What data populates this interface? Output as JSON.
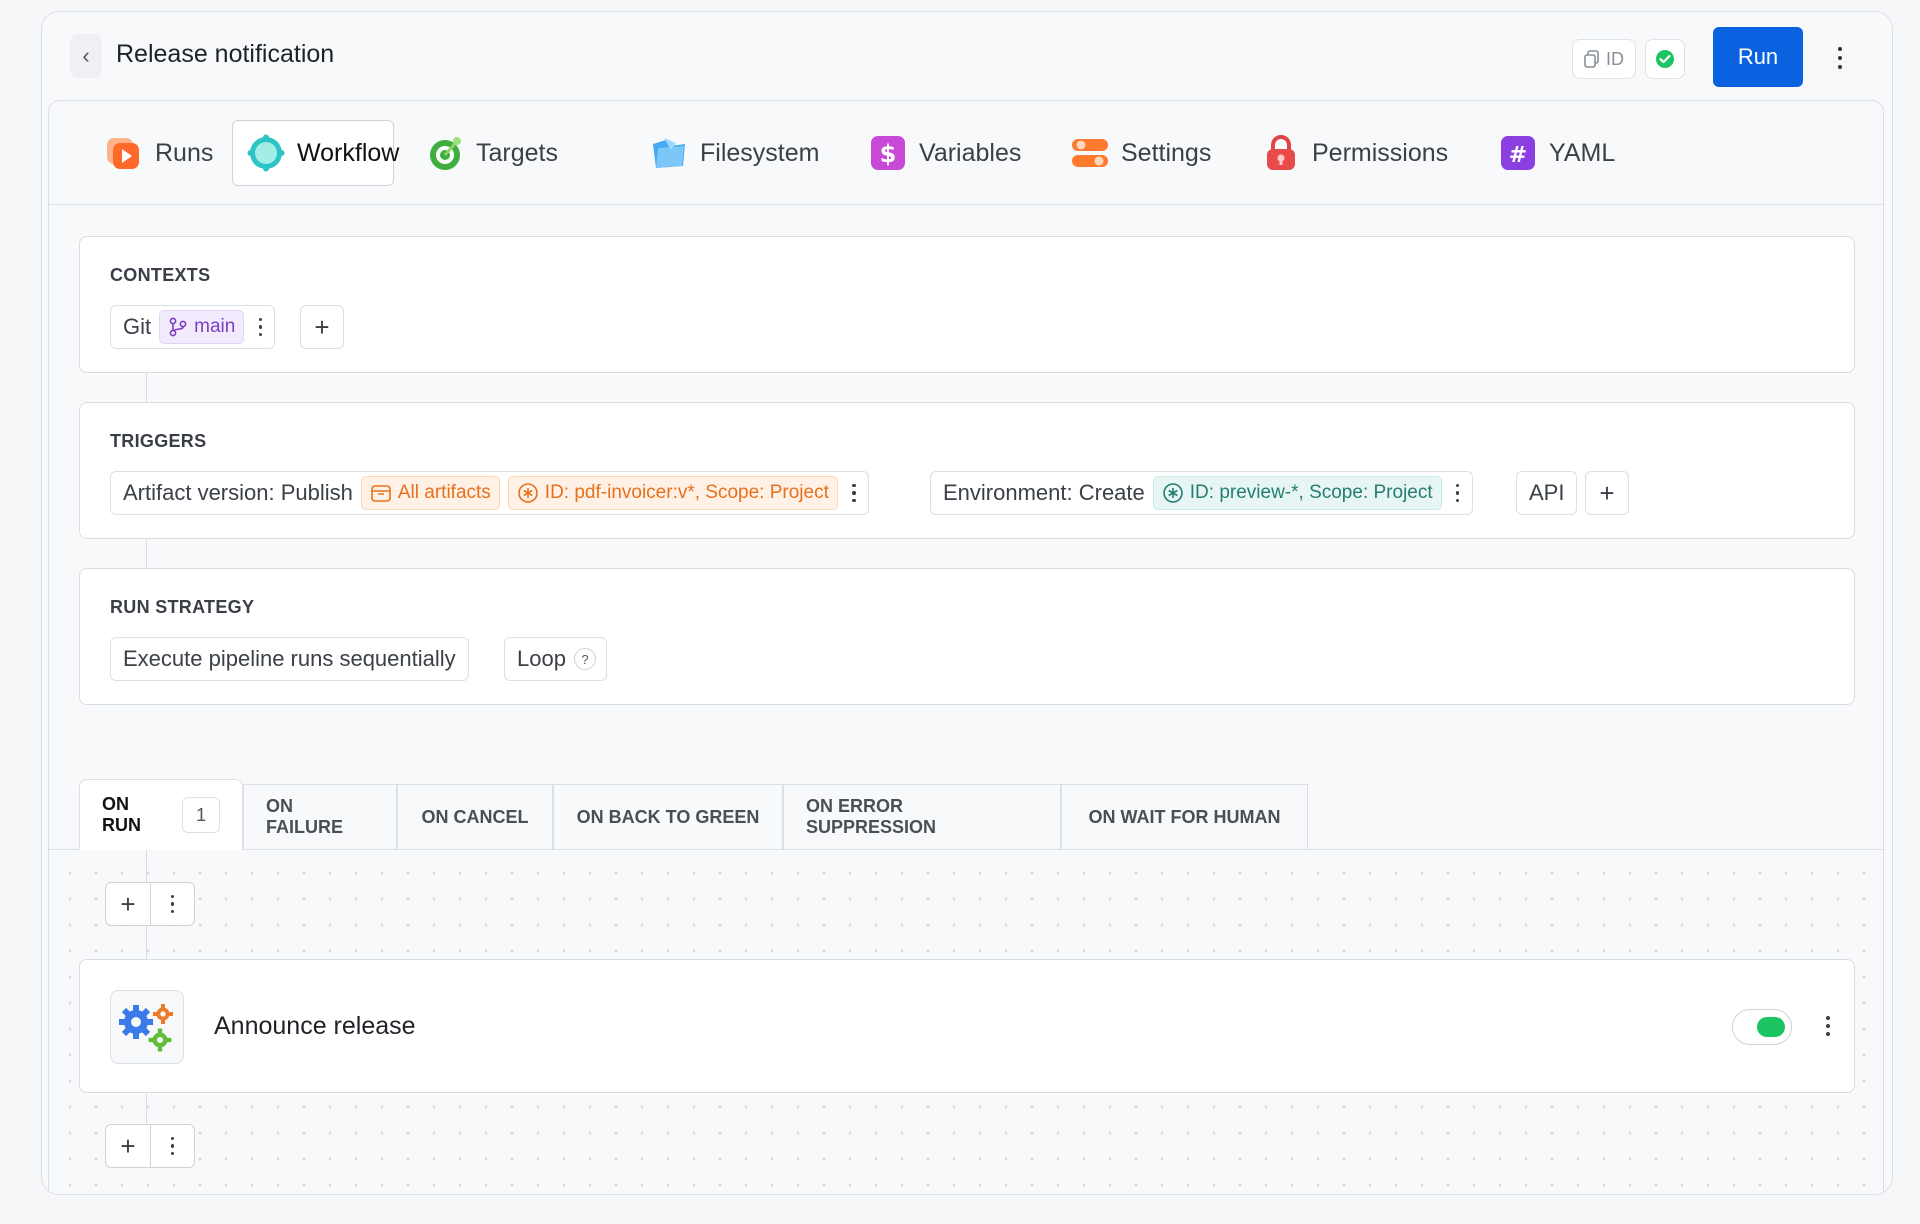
{
  "header": {
    "title": "Release notification",
    "id_label": "ID",
    "run_label": "Run"
  },
  "tabs": [
    {
      "label": "Runs",
      "icon": "runs-icon"
    },
    {
      "label": "Workflow",
      "icon": "workflow-icon",
      "active": true
    },
    {
      "label": "Targets",
      "icon": "targets-icon"
    },
    {
      "label": "Filesystem",
      "icon": "filesystem-icon"
    },
    {
      "label": "Variables",
      "icon": "variables-icon"
    },
    {
      "label": "Settings",
      "icon": "settings-icon"
    },
    {
      "label": "Permissions",
      "icon": "permissions-icon"
    },
    {
      "label": "YAML",
      "icon": "yaml-icon"
    }
  ],
  "contexts": {
    "title": "CONTEXTS",
    "git_label": "Git",
    "branch": "main"
  },
  "triggers": {
    "title": "TRIGGERS",
    "artifact_label": "Artifact version: Publish",
    "artifact_tag": "All artifacts",
    "artifact_scope": "ID: pdf-invoicer:v*, Scope: Project",
    "environment_label": "Environment: Create",
    "environment_scope": "ID: preview-*, Scope: Project",
    "api_label": "API"
  },
  "run_strategy": {
    "title": "RUN STRATEGY",
    "mode": "Execute pipeline runs sequentially",
    "loop_label": "Loop",
    "help": "?"
  },
  "event_tabs": [
    {
      "label": "ON RUN",
      "count": "1",
      "active": true
    },
    {
      "label": "ON FAILURE"
    },
    {
      "label": "ON CANCEL"
    },
    {
      "label": "ON BACK TO GREEN"
    },
    {
      "label": "ON ERROR SUPPRESSION"
    },
    {
      "label": "ON WAIT FOR HUMAN"
    }
  ],
  "step": {
    "name": "Announce release",
    "enabled": true,
    "icon": "gears-icon"
  },
  "colors": {
    "run_button": "#0b62e0",
    "toggle_on": "#1cc462",
    "status_ok": "#1cc462"
  }
}
